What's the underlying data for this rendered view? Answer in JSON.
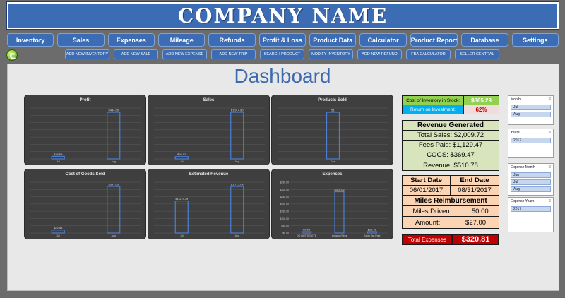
{
  "app": {
    "company_name": "COMPANY NAME",
    "dashboard_title": "Dashboard"
  },
  "nav": [
    "Inventory",
    "Sales",
    "Expenses",
    "Mileage",
    "Refunds",
    "Profit & Loss",
    "Product Data",
    "Calculator",
    "Product Report",
    "Database",
    "Settings"
  ],
  "actions": [
    "ADD NEW INVENTORY",
    "ADD NEW SALE",
    "ADD NEW EXPENSE",
    "ADD NEW TRIP",
    "SEARCH PRODUCT",
    "MODIFY INVENTORY",
    "ADD NEW REFUND",
    "FBA CALCULATOR",
    "SELLER CENTRAL"
  ],
  "stats": {
    "cost_inventory_label": "Cost of Inventory in Stock:",
    "cost_inventory_value": "$865.29",
    "roi_label": "Return on Investment:",
    "roi_value": "62%",
    "revenue_header": "Revenue Generated",
    "total_sales": "Total Sales: $2,009.72",
    "fees_paid": "Fees Paid: $1,129.47",
    "cogs": "COGS: $369.47",
    "revenue": "Revenue: $510.78",
    "start_date_label": "Start Date",
    "end_date_label": "End Date",
    "start_date": "06/01/2017",
    "end_date": "08/31/2017",
    "miles_header": "Miles Reimbursement",
    "miles_driven_label": "Miles Driven:",
    "miles_driven": "50.00",
    "amount_label": "Amount:",
    "amount": "$27.00",
    "total_expenses_label": "Total Expenses",
    "total_expenses": "$320.81"
  },
  "slicers": [
    {
      "title": "Month",
      "items": [
        "Jul",
        "Aug"
      ]
    },
    {
      "title": "Years",
      "items": [
        "2017"
      ]
    },
    {
      "title": "Expense Month",
      "items": [
        "Jun",
        "Jul",
        "Aug"
      ]
    },
    {
      "title": "Expense Years",
      "items": [
        "2017"
      ]
    }
  ],
  "colors": {
    "brand_blue": "#3b6cb4",
    "chart_bg": "#3f3f3f",
    "bar_outline": "#4a7fd4",
    "stat_green": "#d8e4bc",
    "stat_orange": "#fbd4b4",
    "cost_bg": "#92d050",
    "roi_bg": "#00b0f0",
    "roi_value_bg": "#f2dcdb",
    "total_red": "#c00000"
  },
  "icons": {
    "refresh": "refresh-icon",
    "filter": "filter-icon"
  },
  "chart_data": [
    {
      "type": "bar",
      "title": "Profit",
      "categories": [
        "Jul",
        "Aug"
      ],
      "values": [
        26.69,
        484.09
      ],
      "labels": [
        "$26.69",
        "$484.09"
      ]
    },
    {
      "type": "bar",
      "title": "Sales",
      "categories": [
        "Jul",
        "Aug"
      ],
      "values": [
        94.92,
        1914.8
      ],
      "labels": [
        "$94.92",
        "$1,914.80"
      ]
    },
    {
      "type": "bar",
      "title": "Products Sold",
      "categories": [
        "Total"
      ],
      "values": [
        51
      ],
      "labels": [
        "51"
      ]
    },
    {
      "type": "bar",
      "title": "Cost of Goods Sold",
      "categories": [
        "Jul",
        "Aug"
      ],
      "values": [
        22.44,
        347.03
      ],
      "labels": [
        "$22.44",
        "$347.03"
      ]
    },
    {
      "type": "bar",
      "title": "Estimated Revenue",
      "categories": [
        "Jul",
        "Aug"
      ],
      "values": [
        1179.79,
        1715.04
      ],
      "labels": [
        "$1,179.79",
        "$1,715.04"
      ]
    },
    {
      "type": "bar",
      "title": "Expenses",
      "categories": [
        "DO NOT DELETE",
        "Amazon Fees",
        "Sales Tax Paid"
      ],
      "values": [
        0.0,
        310.02,
        10.72
      ],
      "labels": [
        "$0.00",
        "$310.02",
        "$10.72"
      ],
      "yticks": [
        "$0.00",
        "$50.00",
        "$100.00",
        "$150.00",
        "$200.00",
        "$250.00",
        "$300.00",
        "$350.00"
      ],
      "ylim": [
        0,
        350
      ]
    }
  ]
}
